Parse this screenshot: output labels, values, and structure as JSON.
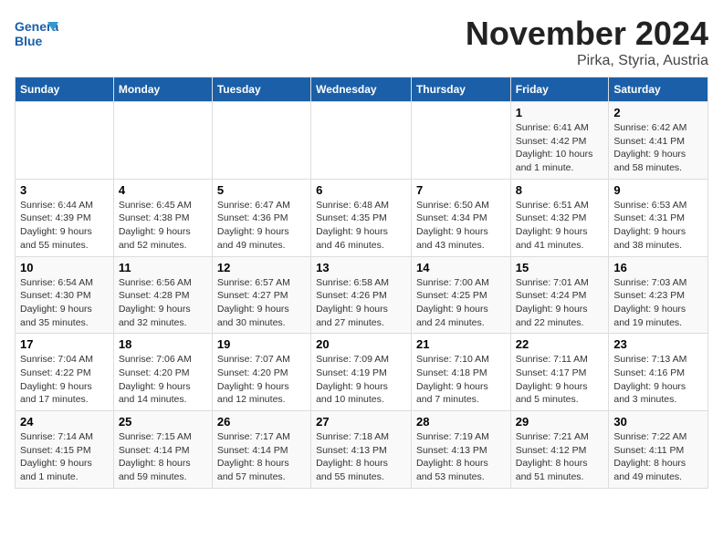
{
  "logo": {
    "name_line1": "General",
    "name_line2": "Blue"
  },
  "title": "November 2024",
  "location": "Pirka, Styria, Austria",
  "headers": [
    "Sunday",
    "Monday",
    "Tuesday",
    "Wednesday",
    "Thursday",
    "Friday",
    "Saturday"
  ],
  "weeks": [
    [
      {
        "day": "",
        "info": ""
      },
      {
        "day": "",
        "info": ""
      },
      {
        "day": "",
        "info": ""
      },
      {
        "day": "",
        "info": ""
      },
      {
        "day": "",
        "info": ""
      },
      {
        "day": "1",
        "info": "Sunrise: 6:41 AM\nSunset: 4:42 PM\nDaylight: 10 hours\nand 1 minute."
      },
      {
        "day": "2",
        "info": "Sunrise: 6:42 AM\nSunset: 4:41 PM\nDaylight: 9 hours\nand 58 minutes."
      }
    ],
    [
      {
        "day": "3",
        "info": "Sunrise: 6:44 AM\nSunset: 4:39 PM\nDaylight: 9 hours\nand 55 minutes."
      },
      {
        "day": "4",
        "info": "Sunrise: 6:45 AM\nSunset: 4:38 PM\nDaylight: 9 hours\nand 52 minutes."
      },
      {
        "day": "5",
        "info": "Sunrise: 6:47 AM\nSunset: 4:36 PM\nDaylight: 9 hours\nand 49 minutes."
      },
      {
        "day": "6",
        "info": "Sunrise: 6:48 AM\nSunset: 4:35 PM\nDaylight: 9 hours\nand 46 minutes."
      },
      {
        "day": "7",
        "info": "Sunrise: 6:50 AM\nSunset: 4:34 PM\nDaylight: 9 hours\nand 43 minutes."
      },
      {
        "day": "8",
        "info": "Sunrise: 6:51 AM\nSunset: 4:32 PM\nDaylight: 9 hours\nand 41 minutes."
      },
      {
        "day": "9",
        "info": "Sunrise: 6:53 AM\nSunset: 4:31 PM\nDaylight: 9 hours\nand 38 minutes."
      }
    ],
    [
      {
        "day": "10",
        "info": "Sunrise: 6:54 AM\nSunset: 4:30 PM\nDaylight: 9 hours\nand 35 minutes."
      },
      {
        "day": "11",
        "info": "Sunrise: 6:56 AM\nSunset: 4:28 PM\nDaylight: 9 hours\nand 32 minutes."
      },
      {
        "day": "12",
        "info": "Sunrise: 6:57 AM\nSunset: 4:27 PM\nDaylight: 9 hours\nand 30 minutes."
      },
      {
        "day": "13",
        "info": "Sunrise: 6:58 AM\nSunset: 4:26 PM\nDaylight: 9 hours\nand 27 minutes."
      },
      {
        "day": "14",
        "info": "Sunrise: 7:00 AM\nSunset: 4:25 PM\nDaylight: 9 hours\nand 24 minutes."
      },
      {
        "day": "15",
        "info": "Sunrise: 7:01 AM\nSunset: 4:24 PM\nDaylight: 9 hours\nand 22 minutes."
      },
      {
        "day": "16",
        "info": "Sunrise: 7:03 AM\nSunset: 4:23 PM\nDaylight: 9 hours\nand 19 minutes."
      }
    ],
    [
      {
        "day": "17",
        "info": "Sunrise: 7:04 AM\nSunset: 4:22 PM\nDaylight: 9 hours\nand 17 minutes."
      },
      {
        "day": "18",
        "info": "Sunrise: 7:06 AM\nSunset: 4:20 PM\nDaylight: 9 hours\nand 14 minutes."
      },
      {
        "day": "19",
        "info": "Sunrise: 7:07 AM\nSunset: 4:20 PM\nDaylight: 9 hours\nand 12 minutes."
      },
      {
        "day": "20",
        "info": "Sunrise: 7:09 AM\nSunset: 4:19 PM\nDaylight: 9 hours\nand 10 minutes."
      },
      {
        "day": "21",
        "info": "Sunrise: 7:10 AM\nSunset: 4:18 PM\nDaylight: 9 hours\nand 7 minutes."
      },
      {
        "day": "22",
        "info": "Sunrise: 7:11 AM\nSunset: 4:17 PM\nDaylight: 9 hours\nand 5 minutes."
      },
      {
        "day": "23",
        "info": "Sunrise: 7:13 AM\nSunset: 4:16 PM\nDaylight: 9 hours\nand 3 minutes."
      }
    ],
    [
      {
        "day": "24",
        "info": "Sunrise: 7:14 AM\nSunset: 4:15 PM\nDaylight: 9 hours\nand 1 minute."
      },
      {
        "day": "25",
        "info": "Sunrise: 7:15 AM\nSunset: 4:14 PM\nDaylight: 8 hours\nand 59 minutes."
      },
      {
        "day": "26",
        "info": "Sunrise: 7:17 AM\nSunset: 4:14 PM\nDaylight: 8 hours\nand 57 minutes."
      },
      {
        "day": "27",
        "info": "Sunrise: 7:18 AM\nSunset: 4:13 PM\nDaylight: 8 hours\nand 55 minutes."
      },
      {
        "day": "28",
        "info": "Sunrise: 7:19 AM\nSunset: 4:13 PM\nDaylight: 8 hours\nand 53 minutes."
      },
      {
        "day": "29",
        "info": "Sunrise: 7:21 AM\nSunset: 4:12 PM\nDaylight: 8 hours\nand 51 minutes."
      },
      {
        "day": "30",
        "info": "Sunrise: 7:22 AM\nSunset: 4:11 PM\nDaylight: 8 hours\nand 49 minutes."
      }
    ]
  ]
}
